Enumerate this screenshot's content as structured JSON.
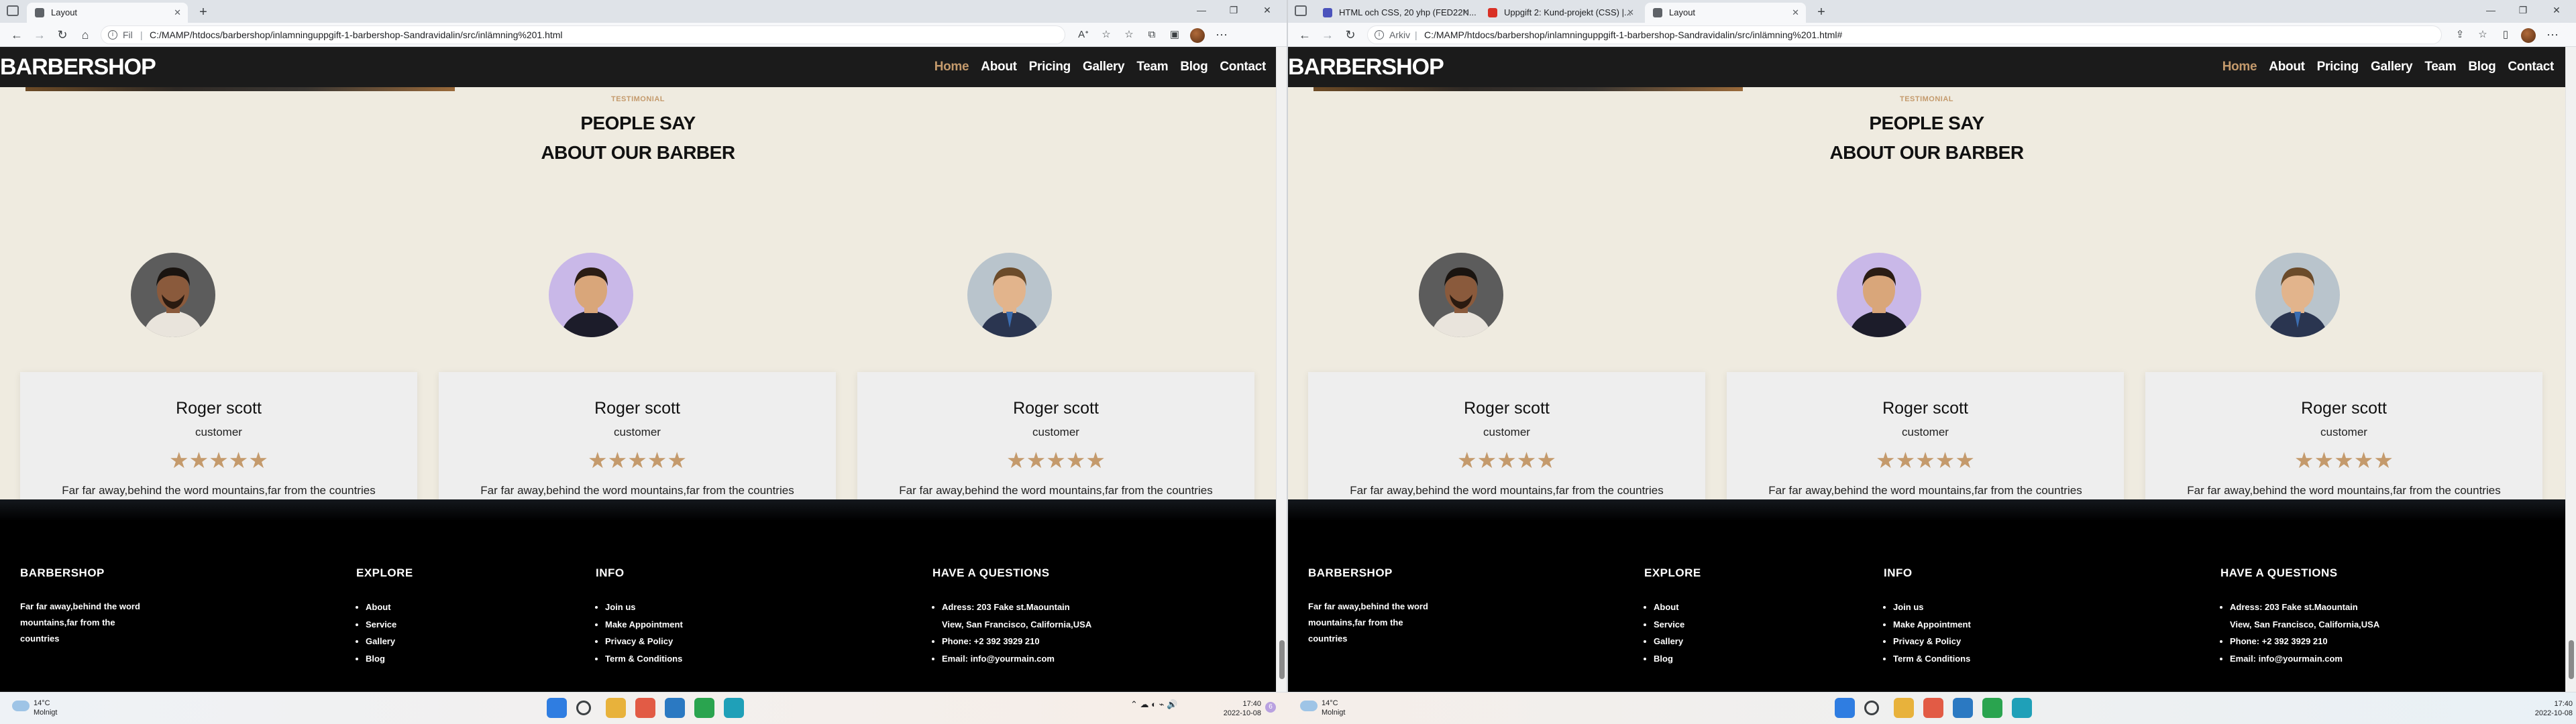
{
  "windows": [
    {
      "tabs": [
        {
          "label": "Layout",
          "favicon_color": "#5f6368",
          "active": true
        }
      ],
      "address": {
        "scheme": "Fil",
        "url": "C:/MAMP/htdocs/barbershop/inlamninguppgift-1-barbershop-Sandravidalin/src/inlämning%201.html"
      },
      "scroll_fraction": 0.28
    },
    {
      "tabs": [
        {
          "label": "HTML och CSS, 20 yhp (FED22N...",
          "favicon_color": "#4b53bc",
          "active": false
        },
        {
          "label": "Uppgift 2: Kund-projekt (CSS) |...",
          "favicon_color": "#d93025",
          "active": false
        },
        {
          "label": "Layout",
          "favicon_color": "#5f6368",
          "active": true
        }
      ],
      "address": {
        "scheme": "Arkiv",
        "url": "C:/MAMP/htdocs/barbershop/inlamninguppgift-1-barbershop-Sandravidalin/src/inlämning%201.html#"
      },
      "scroll_fraction": 0.28
    }
  ],
  "site": {
    "brand": "BARBERSHOP",
    "menu": [
      "Home",
      "About",
      "Pricing",
      "Gallery",
      "Team",
      "Blog",
      "Contact"
    ],
    "active_menu": "Home",
    "accent_color": "#c49a6c",
    "testimonial": {
      "subheading": "TESTIMONIAL",
      "title_line1": "PEOPLE SAY",
      "title_line2": "ABOUT OUR BARBER",
      "cards": [
        {
          "name": "Roger scott",
          "role": "customer",
          "stars": "★★★★★",
          "rating": 5,
          "text": "Far far away,behind the word mountains,far from the countries Vokalia and Consonantia, there live the blind texts.",
          "avatar": "barber-portrait-1"
        },
        {
          "name": "Roger scott",
          "role": "customer",
          "stars": "★★★★★",
          "rating": 5,
          "text": "Far far away,behind the word mountains,far from the countries Vokalia and Consonantia, there live the blind texts.",
          "avatar": "barber-portrait-2"
        },
        {
          "name": "Roger scott",
          "role": "customer",
          "stars": "★★★★★",
          "rating": 5,
          "text": "Far far away,behind the word mountains,far from the countries Vokalia and Consonantia, there live the blind texts.",
          "avatar": "barber-portrait-3"
        }
      ]
    },
    "footer": {
      "about": {
        "title": "BARBERSHOP",
        "text": "Far far away,behind the word mountains,far from the countries"
      },
      "explore": {
        "title": "EXPLORE",
        "items": [
          "About",
          "Service",
          "Gallery",
          "Blog"
        ]
      },
      "info": {
        "title": "INFO",
        "items": [
          "Join us",
          "Make Appointment",
          "Privacy & Policy",
          "Term & Conditions"
        ]
      },
      "contact": {
        "title": "HAVE A QUESTIONS",
        "items": [
          "Adress: 203 Fake st.Maountain View, San Francisco, California,USA",
          "Phone: +2 392 3929 210",
          "Email: info@yourmain.com"
        ]
      }
    }
  },
  "taskbar": {
    "weather_temp": "14°C",
    "weather_desc": "Molnigt",
    "clock_time": "17:40",
    "clock_date": "2022-10-08",
    "notification_count": "6",
    "apps": [
      "start-icon",
      "search-icon",
      "file-explorer-icon",
      "chrome-icon",
      "vscode-icon",
      "spotify-icon",
      "edge-icon"
    ]
  }
}
